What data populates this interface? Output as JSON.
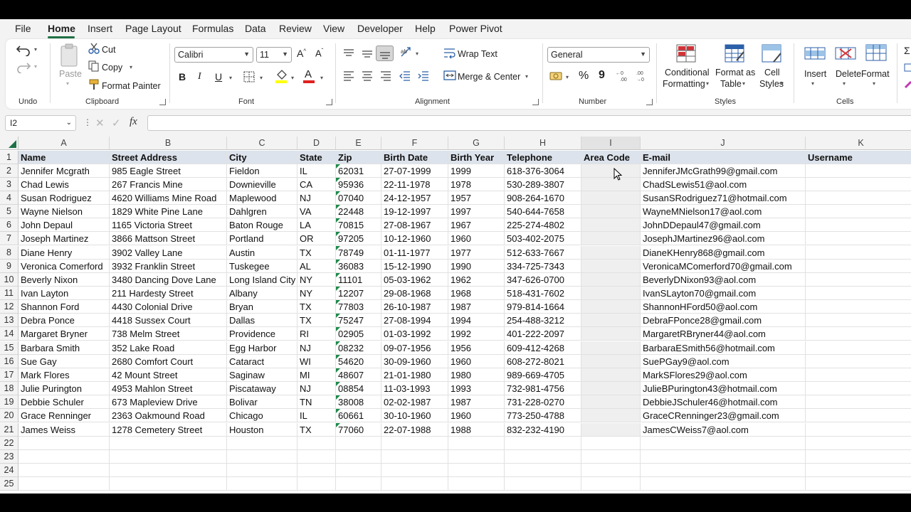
{
  "menu": {
    "tabs": [
      "File",
      "Home",
      "Insert",
      "Page Layout",
      "Formulas",
      "Data",
      "Review",
      "View",
      "Developer",
      "Help",
      "Power Pivot"
    ],
    "active": "Home"
  },
  "ribbon": {
    "undo": {
      "group": "Undo"
    },
    "clipboard": {
      "group": "Clipboard",
      "paste": "Paste",
      "cut": "Cut",
      "copy": "Copy",
      "format_painter": "Format Painter"
    },
    "font": {
      "group": "Font",
      "name": "Calibri",
      "size": "11",
      "bold": "B",
      "italic": "I",
      "underline": "U"
    },
    "alignment": {
      "group": "Alignment",
      "wrap_text": "Wrap Text",
      "merge_center": "Merge & Center"
    },
    "number": {
      "group": "Number",
      "format": "General",
      "percent": "%",
      "comma": "9"
    },
    "styles": {
      "group": "Styles",
      "conditional": "Conditional",
      "conditional2": "Formatting",
      "format_as": "Format as",
      "format_as2": "Table",
      "cell": "Cell",
      "cell2": "Styles"
    },
    "cells": {
      "group": "Cells",
      "insert": "Insert",
      "delete": "Delete",
      "format": "Format"
    }
  },
  "formula_bar": {
    "name_box": "I2",
    "fx": "fx",
    "content": ""
  },
  "columns": [
    "A",
    "B",
    "C",
    "D",
    "E",
    "F",
    "G",
    "H",
    "I",
    "J",
    "K"
  ],
  "rows": [
    "1",
    "2",
    "3",
    "4",
    "5",
    "6",
    "7",
    "8",
    "9",
    "10",
    "11",
    "12",
    "13",
    "14",
    "15",
    "16",
    "17",
    "18",
    "19",
    "20",
    "21",
    "22",
    "23",
    "24",
    "25"
  ],
  "headers": [
    "Name",
    "Street Address",
    "City",
    "State",
    "Zip",
    "Birth Date",
    "Birth Year",
    "Telephone",
    "Area Code",
    "E-mail",
    "Username"
  ],
  "data": [
    [
      "Jennifer Mcgrath",
      "985 Eagle Street",
      "Fieldon",
      "IL",
      "62031",
      "27-07-1999",
      "1999",
      "618-376-3064",
      "",
      "JenniferJMcGrath99@gmail.com",
      ""
    ],
    [
      "Chad Lewis",
      "267 Francis Mine",
      "Downieville",
      "CA",
      "95936",
      "22-11-1978",
      "1978",
      "530-289-3807",
      "",
      "ChadSLewis51@aol.com",
      ""
    ],
    [
      "Susan Rodriguez",
      "4620 Williams Mine Road",
      "Maplewood",
      "NJ",
      "07040",
      "24-12-1957",
      "1957",
      "908-264-1670",
      "",
      "SusanSRodriguez71@hotmail.com",
      ""
    ],
    [
      "Wayne Nielson",
      "1829 White Pine Lane",
      "Dahlgren",
      "VA",
      "22448",
      "19-12-1997",
      "1997",
      "540-644-7658",
      "",
      "WayneMNielson17@aol.com",
      ""
    ],
    [
      "John Depaul",
      "1165 Victoria Street",
      "Baton Rouge",
      "LA",
      "70815",
      "27-08-1967",
      "1967",
      "225-274-4802",
      "",
      "JohnDDepaul47@gmail.com",
      ""
    ],
    [
      "Joseph Martinez",
      "3866 Mattson Street",
      "Portland",
      "OR",
      "97205",
      "10-12-1960",
      "1960",
      "503-402-2075",
      "",
      "JosephJMartinez96@aol.com",
      ""
    ],
    [
      "Diane Henry",
      "3902 Valley Lane",
      "Austin",
      "TX",
      "78749",
      "01-11-1977",
      "1977",
      "512-633-7667",
      "",
      "DianeKHenry868@gmail.com",
      ""
    ],
    [
      "Veronica Comerford",
      "3932 Franklin Street",
      "Tuskegee",
      "AL",
      "36083",
      "15-12-1990",
      "1990",
      "334-725-7343",
      "",
      "VeronicaMComerford70@gmail.com",
      ""
    ],
    [
      "Beverly Nixon",
      "3480 Dancing Dove Lane",
      "Long Island City",
      "NY",
      "11101",
      "05-03-1962",
      "1962",
      "347-626-0700",
      "",
      "BeverlyDNixon93@aol.com",
      ""
    ],
    [
      "Ivan Layton",
      "211 Hardesty Street",
      "Albany",
      "NY",
      "12207",
      "29-08-1968",
      "1968",
      "518-431-7602",
      "",
      "IvanSLayton70@gmail.com",
      ""
    ],
    [
      "Shannon Ford",
      "4430 Colonial Drive",
      "Bryan",
      "TX",
      "77803",
      "26-10-1987",
      "1987",
      "979-814-1664",
      "",
      "ShannonHFord50@aol.com",
      ""
    ],
    [
      "Debra Ponce",
      "4418 Sussex Court",
      "Dallas",
      "TX",
      "75247",
      "27-08-1994",
      "1994",
      "254-488-3212",
      "",
      "DebraFPonce28@gmail.com",
      ""
    ],
    [
      "Margaret Bryner",
      "738 Melm Street",
      "Providence",
      "RI",
      "02905",
      "01-03-1992",
      "1992",
      "401-222-2097",
      "",
      "MargaretRBryner44@aol.com",
      ""
    ],
    [
      "Barbara Smith",
      "352 Lake Road",
      "Egg Harbor",
      "NJ",
      "08232",
      "09-07-1956",
      "1956",
      "609-412-4268",
      "",
      "BarbaraESmith56@hotmail.com",
      ""
    ],
    [
      "Sue Gay",
      "2680 Comfort Court",
      "Cataract",
      "WI",
      "54620",
      "30-09-1960",
      "1960",
      "608-272-8021",
      "",
      "SuePGay9@aol.com",
      ""
    ],
    [
      "Mark Flores",
      "42 Mount Street",
      "Saginaw",
      "MI",
      "48607",
      "21-01-1980",
      "1980",
      "989-669-4705",
      "",
      "MarkSFlores29@aol.com",
      ""
    ],
    [
      "Julie Purington",
      "4953 Mahlon Street",
      "Piscataway",
      "NJ",
      "08854",
      "11-03-1993",
      "1993",
      "732-981-4756",
      "",
      "JulieBPurington43@hotmail.com",
      ""
    ],
    [
      "Debbie Schuler",
      "673 Mapleview Drive",
      "Bolivar",
      "TN",
      "38008",
      "02-02-1987",
      "1987",
      "731-228-0270",
      "",
      "DebbieJSchuler46@hotmail.com",
      ""
    ],
    [
      "Grace Renninger",
      "2363 Oakmound Road",
      "Chicago",
      "IL",
      "60661",
      "30-10-1960",
      "1960",
      "773-250-4788",
      "",
      "GraceCRenninger23@gmail.com",
      ""
    ],
    [
      "James Weiss",
      "1278 Cemetery Street",
      "Houston",
      "TX",
      "77060",
      "22-07-1988",
      "1988",
      "832-232-4190",
      "",
      "JamesCWeiss7@aol.com",
      ""
    ]
  ],
  "accent_color": "#1e7145"
}
